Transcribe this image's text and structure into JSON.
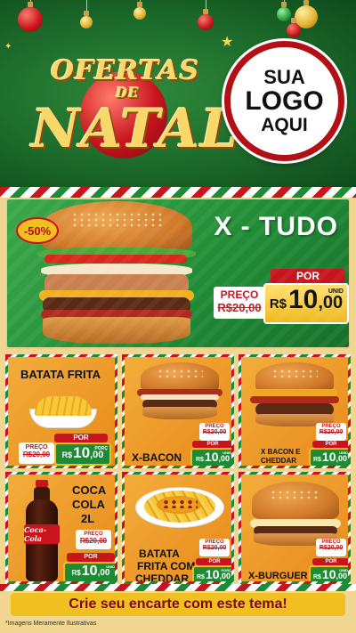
{
  "header": {
    "title_line1": "OFERTAS",
    "title_line2": "DE",
    "title_line3": "NATAL",
    "logo_line1": "SUA",
    "logo_line2": "LOGO",
    "logo_line3": "AQUI"
  },
  "main_offer": {
    "name": "X - TUDO",
    "discount": "-50%",
    "old_label": "PREÇO",
    "old_price": "R$20,00",
    "por_label": "POR",
    "currency": "R$",
    "price_int": "10",
    "price_dec": ",00",
    "unit": "UNID"
  },
  "products": [
    {
      "name": "BATATA FRITA",
      "old_label": "PREÇO",
      "old_price": "R$20,00",
      "por_label": "POR",
      "currency": "R$",
      "price_int": "10",
      "price_dec": ",00",
      "unit": "PORÇ"
    },
    {
      "name": "X-BACON",
      "old_label": "PREÇO",
      "old_price": "R$20,00",
      "por_label": "POR",
      "currency": "R$",
      "price_int": "10",
      "price_dec": ",00",
      "unit": "UNID"
    },
    {
      "name_l1": "X BACON E",
      "name_l2": "CHEDDAR",
      "old_label": "PREÇO",
      "old_price": "R$20,00",
      "por_label": "POR",
      "currency": "R$",
      "price_int": "10",
      "price_dec": ",00",
      "unit": "UNID"
    },
    {
      "name_l1": "COCA",
      "name_l2": "COLA",
      "name_l3": "2L",
      "old_label": "PREÇO",
      "old_price": "R$20,00",
      "por_label": "POR",
      "currency": "R$",
      "price_int": "10",
      "price_dec": ",00",
      "unit": "UNID",
      "bottle_label": "Coca-Cola"
    },
    {
      "name_l1": "BATATA",
      "name_l2": "FRITA COM",
      "name_l3": "CHEDDAR",
      "old_label": "PREÇO",
      "old_price": "R$20,00",
      "por_label": "POR",
      "currency": "R$",
      "price_int": "10",
      "price_dec": ",00",
      "unit": "PORÇ"
    },
    {
      "name": "X-BURGUER",
      "old_label": "PREÇO",
      "old_price": "R$20,00",
      "por_label": "POR",
      "currency": "R$",
      "price_int": "10",
      "price_dec": ",00",
      "unit": "UNID"
    }
  ],
  "footer": {
    "cta": "Crie seu encarte com este tema!",
    "disclaimer": "*Imagens Meramente Ilustrativas"
  },
  "colors": {
    "brand_red": "#c8141c",
    "brand_green": "#1f8a35",
    "gold": "#f0c020",
    "card_orange": "#f3ad3a"
  }
}
